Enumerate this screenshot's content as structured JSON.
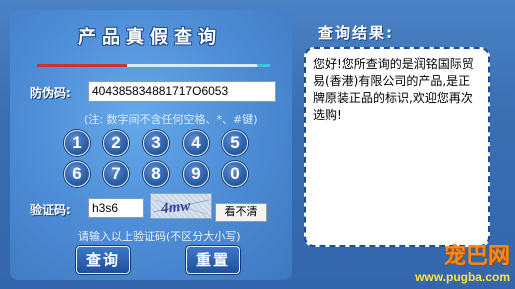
{
  "query": {
    "title": "产品真假查询",
    "code_label": "防伪码:",
    "code_value": "404385834881717O6053",
    "hint": "(注: 数字间不含任何空格、*、#键)",
    "keypad": [
      "1",
      "2",
      "3",
      "4",
      "5",
      "6",
      "7",
      "8",
      "9",
      "0"
    ],
    "captcha_label": "验证码:",
    "captcha_value": "h3s6",
    "captcha_image_text": "4mw",
    "captcha_refresh_label": "看不清",
    "captcha_hint": "请输入以上验证码(不区分大小写)",
    "search_button": "查询",
    "reset_button": "重置"
  },
  "result": {
    "title": "查询结果:",
    "message": "您好!您所查询的是润铭国际贸易(香港)有限公司的产品,是正牌原装正品的标识,欢迎您再次选购!"
  },
  "watermark": {
    "logo": "宠巴网",
    "url": "www.pugba.com"
  },
  "colors": {
    "background": "#3f75b7",
    "panel": "#4f8fd8",
    "accent_red": "#c8333a",
    "accent_cyan": "#39c8d5",
    "result_border": "#1e4d96",
    "watermark_orange": "#ff8a14"
  }
}
